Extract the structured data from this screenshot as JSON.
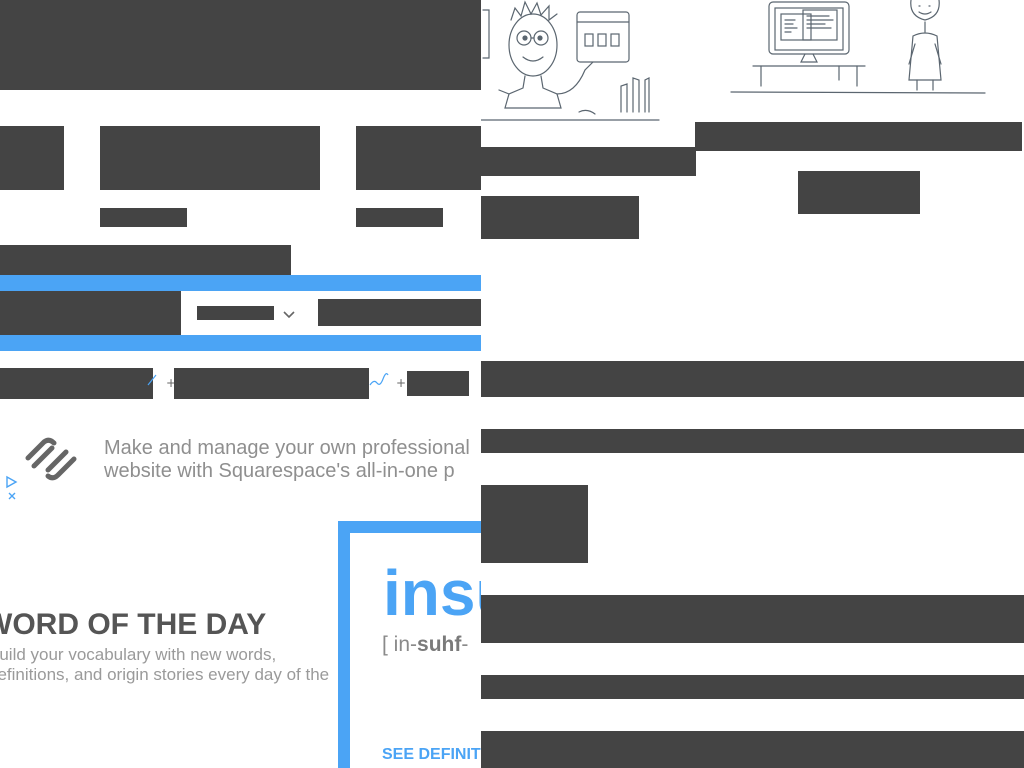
{
  "search": {
    "select_icon": "chevron-down-icon"
  },
  "trend": {
    "separator": "+"
  },
  "ad": {
    "line1": "Make and manage your own professional",
    "line2": "website with Squarespace's all-in-one p",
    "logo_icon": "squarespace-logo-icon",
    "adchoices_icon": "adchoices-icon"
  },
  "word_of_the_day": {
    "title": "WORD OF THE DAY",
    "desc_line1": "Build your vocabulary with new words,",
    "desc_line2": "definitions, and origin stories every day of the",
    "word": "insu",
    "pron_prefix": "[ in-",
    "pron_stress": "suhf",
    "pron_suffix": "-",
    "cta": "SEE DEFINIT"
  },
  "colors": {
    "accent": "#4ba4f5",
    "redaction": "#444444",
    "muted_text": "#8f8f8f"
  }
}
